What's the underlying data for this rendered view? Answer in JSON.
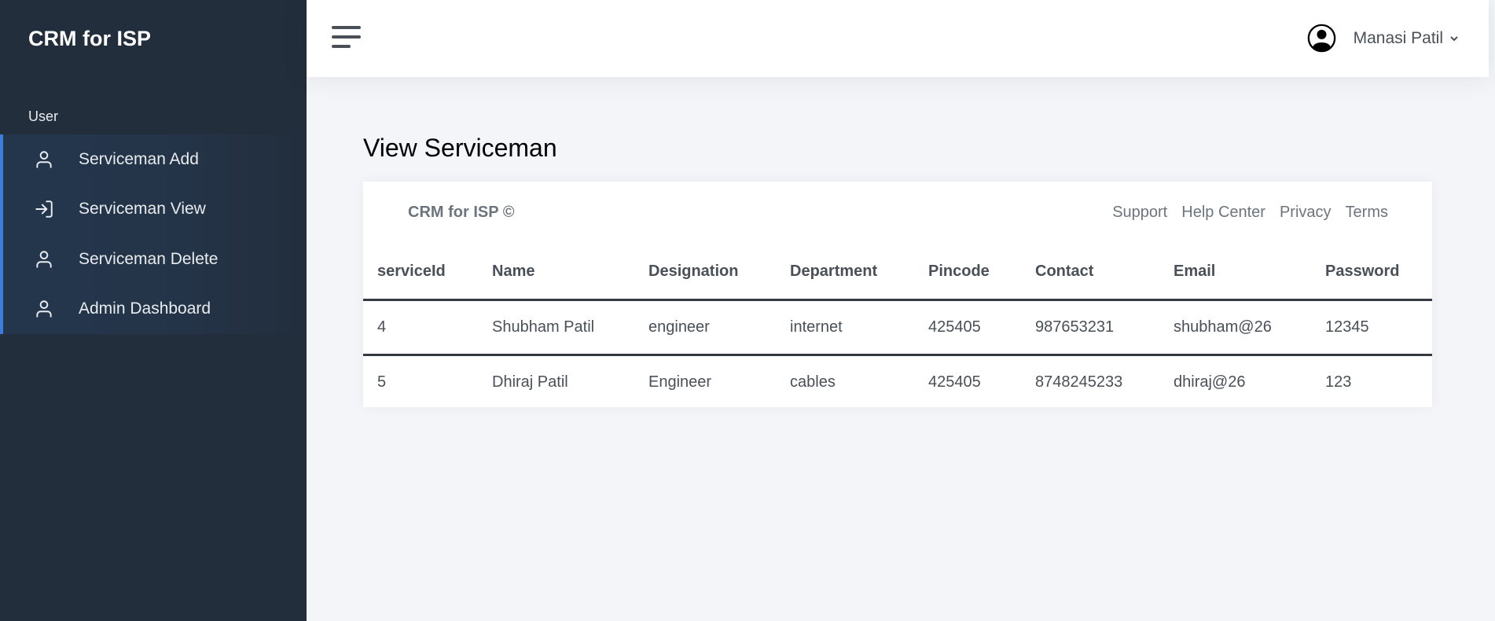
{
  "brand": "CRM for ISP",
  "sidebar": {
    "section_header": "User",
    "items": [
      {
        "label": "Serviceman Add",
        "icon": "user-icon"
      },
      {
        "label": "Serviceman View",
        "icon": "sign-in-icon"
      },
      {
        "label": "Serviceman Delete",
        "icon": "user-icon"
      },
      {
        "label": "Admin Dashboard",
        "icon": "user-icon"
      }
    ]
  },
  "topbar": {
    "menu_icon": "hamburger-icon",
    "user_name": "Manasi Patil",
    "avatar_icon": "user-circle-icon"
  },
  "main": {
    "page_title": "View Serviceman",
    "footer": {
      "brand": "CRM for ISP ©",
      "links": [
        "Support",
        "Help Center",
        "Privacy",
        "Terms"
      ]
    },
    "table": {
      "columns": [
        "serviceId",
        "Name",
        "Designation",
        "Department",
        "Pincode",
        "Contact",
        "Email",
        "Password"
      ],
      "rows": [
        [
          "4",
          "Shubham Patil",
          "engineer",
          "internet",
          "425405",
          "987653231",
          "shubham@26",
          "12345"
        ],
        [
          "5",
          "Dhiraj Patil",
          "Engineer",
          "cables",
          "425405",
          "8748245233",
          "dhiraj@26",
          "123"
        ]
      ]
    }
  },
  "colors": {
    "sidebar_bg": "#222e3c",
    "accent": "#3b7ddd",
    "page_bg": "#f4f5f9"
  }
}
